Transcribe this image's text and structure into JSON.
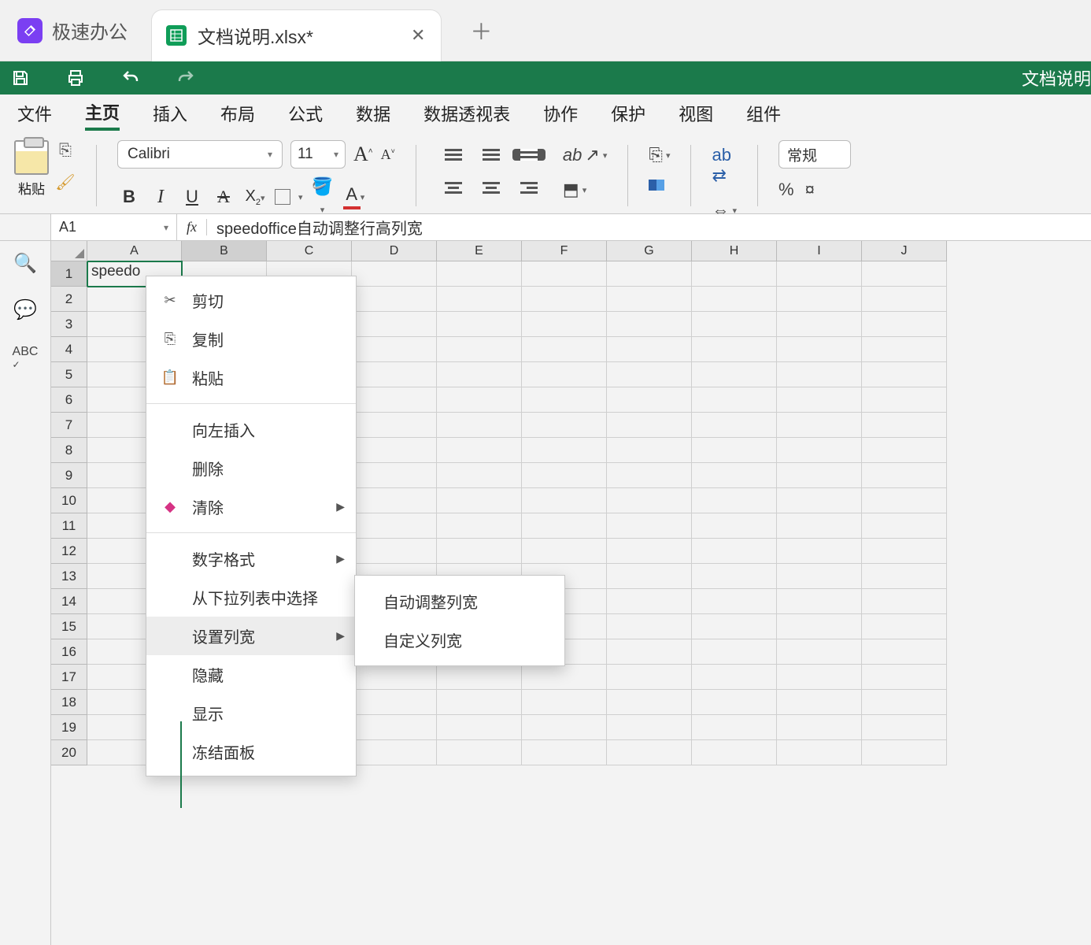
{
  "app": {
    "name": "极速办公",
    "tab_title": "文档说明.xlsx*",
    "right_label": "文档说明"
  },
  "menu": {
    "items": [
      "文件",
      "主页",
      "插入",
      "布局",
      "公式",
      "数据",
      "数据透视表",
      "协作",
      "保护",
      "视图",
      "组件"
    ],
    "active": "主页"
  },
  "ribbon": {
    "paste_label": "粘贴",
    "font_name": "Calibri",
    "font_size": "11",
    "number_format": "常规"
  },
  "cellref": {
    "name": "A1",
    "formula": "speedoffice自动调整行高列宽"
  },
  "grid": {
    "columns": [
      "A",
      "B",
      "C",
      "D",
      "E",
      "F",
      "G",
      "H",
      "I",
      "J"
    ],
    "rows": 20,
    "a1_value": "speedoffice自动调整行高列宽"
  },
  "context_menu": {
    "cut": "剪切",
    "copy": "复制",
    "paste": "粘贴",
    "insert_left": "向左插入",
    "delete": "删除",
    "clear": "清除",
    "number_format": "数字格式",
    "from_dropdown": "从下拉列表中选择",
    "set_col_width": "设置列宽",
    "hide": "隐藏",
    "show": "显示",
    "freeze": "冻结面板"
  },
  "submenu": {
    "autofit": "自动调整列宽",
    "custom": "自定义列宽"
  }
}
